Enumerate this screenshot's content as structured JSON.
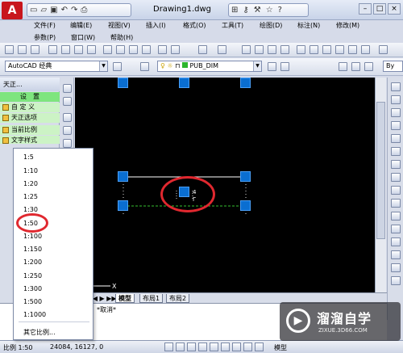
{
  "app": {
    "logo_letter": "A",
    "doc_title": "Drawing1.dwg",
    "window_controls": [
      "–",
      "□",
      "×"
    ]
  },
  "qat_icons": [
    "new",
    "open",
    "save",
    "undo",
    "redo",
    "print"
  ],
  "title_tools": [
    "binoculars",
    "key",
    "tool",
    "star",
    "help"
  ],
  "menu": {
    "row1": [
      "文件(F)",
      "编辑(E)",
      "视图(V)",
      "插入(I)",
      "格式(O)",
      "工具(T)",
      "绘图(D)",
      "标注(N)",
      "修改(M)"
    ],
    "row2": [
      "参数(P)",
      "窗口(W)",
      "帮助(H)"
    ]
  },
  "toolbar": {
    "workspace": "AutoCAD 经典",
    "layer": "PUB_DIM",
    "color": "By"
  },
  "left_panel": {
    "header": "天正...",
    "section": "设　置",
    "items": [
      "自 定 义",
      "天正选项",
      "当前比例",
      "文字样式"
    ]
  },
  "canvas": {
    "axis_x": "X",
    "dim_text_1": "4",
    "dim_text_2": "Γ"
  },
  "tabs": [
    "模型",
    "布局1",
    "布局2"
  ],
  "command": {
    "line1": "*取消*",
    "line2": ""
  },
  "scale_menu": {
    "options": [
      "1:5",
      "1:10",
      "1:20",
      "1:25",
      "1:30",
      "1:50",
      "1:100",
      "1:150",
      "1:200",
      "1:250",
      "1:300",
      "1:500",
      "1:1000"
    ],
    "selected": "1:50",
    "other": "其它比例..."
  },
  "status": {
    "scale": "比例 1:50",
    "coords": "24084, 16127, 0",
    "model": "模型"
  },
  "watermark": {
    "logo": "▶",
    "title": "溜溜自学",
    "url": "ZIXUE.3D66.COM"
  },
  "colors": {
    "grip": "#0a6ed1",
    "highlight": "#e0282f",
    "canvas": "#000000",
    "panel_green": "#7ee57e"
  }
}
